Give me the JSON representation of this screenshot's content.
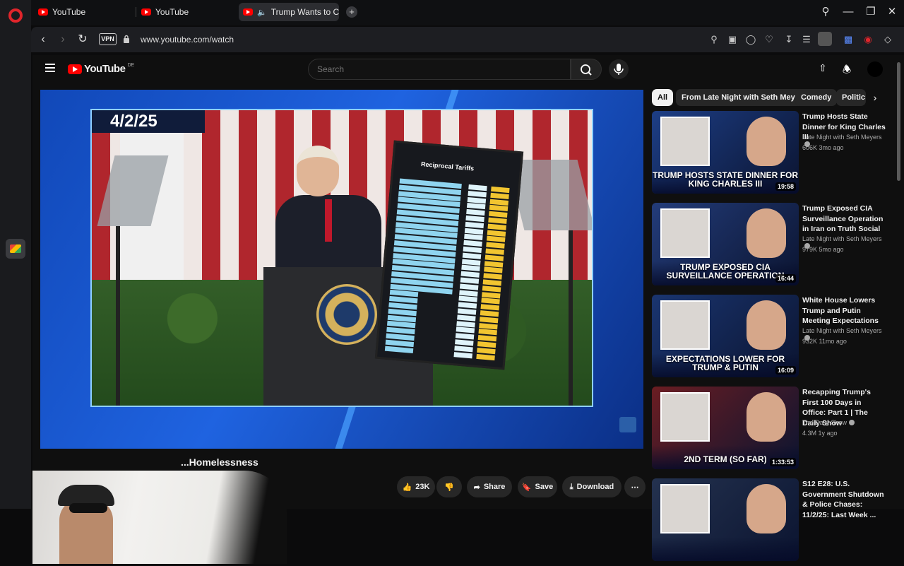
{
  "browser": {
    "tabs": [
      {
        "label": "YouTube",
        "active": false
      },
      {
        "label": "YouTube",
        "active": false
      },
      {
        "label": "Trump Wants to Crack",
        "active": true
      }
    ],
    "new_tab": "+",
    "address": {
      "vpn": "VPN",
      "url": "www.youtube.com/watch"
    }
  },
  "youtube": {
    "logo": {
      "word": "YouTube",
      "country": "DE"
    },
    "search": {
      "placeholder": "Search"
    },
    "chips": [
      "All",
      "From Late Night with Seth Meyers",
      "Comedy",
      "Politic"
    ],
    "video": {
      "date_banner": "4/2/25",
      "board_title": "Reciprocal Tariffs",
      "title": "...Homelessness"
    },
    "actions": {
      "likes": "23K",
      "share": "Share",
      "save": "Save",
      "download": "Download"
    },
    "related": [
      {
        "title": "Trump Hosts State Dinner for King Charles III",
        "channel": "Late Night with Seth Meyers",
        "meta": "606K  3mo ago",
        "duration": "19:58",
        "caption": "TRUMP HOSTS STATE DINNER FOR KING CHARLES III",
        "bg": "#1d3e86"
      },
      {
        "title": "Trump Exposed CIA Surveillance Operation in Iran on Truth Social",
        "channel": "Late Night with Seth Meyers",
        "meta": "979K  5mo ago",
        "duration": "16:44",
        "caption": "TRUMP EXPOSED CIA SURVEILLANCE OPERATION",
        "bg": "#233c7a"
      },
      {
        "title": "White House Lowers Trump and Putin Meeting Expectations",
        "channel": "Late Night with Seth Meyers",
        "meta": "932K  11mo ago",
        "duration": "16:09",
        "caption": "EXPECTATIONS LOWER FOR TRUMP & PUTIN",
        "bg": "#1a3570"
      },
      {
        "title": "Recapping Trump's First 100 Days in Office: Part 1 | The Daily Show",
        "channel": "The Daily Show",
        "meta": "4.3M  1y ago",
        "duration": "1:33:53",
        "caption": "2ND TERM (SO FAR)",
        "bg": "#6b1d22"
      },
      {
        "title": "S12 E28: U.S. Government Shutdown & Police Chases: 11/2/25: Last Week ...",
        "channel": "",
        "meta": "",
        "duration": "",
        "caption": "",
        "bg": "#24324f"
      }
    ]
  }
}
